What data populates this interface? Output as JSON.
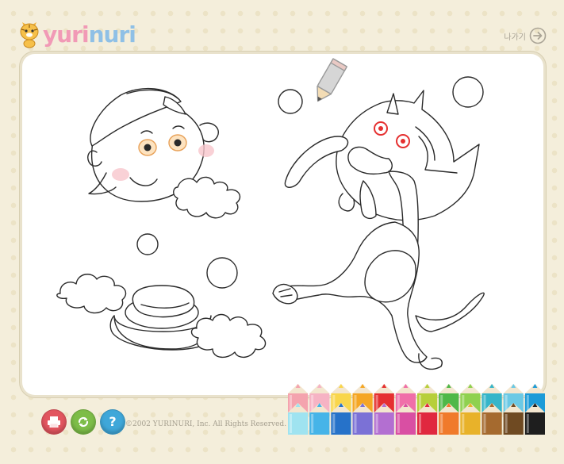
{
  "brand": {
    "logo_part1": "yuri",
    "logo_part2": "nuri"
  },
  "header": {
    "exit_label": "나가기"
  },
  "footer": {
    "copyright": "©2002 YURINURI, Inc. All Rights Reserved."
  },
  "toolbar": {
    "print_icon": "printer-icon",
    "reset_icon": "refresh-icon",
    "help_icon": "help-icon",
    "help_glyph": "?"
  },
  "palette": {
    "top_row": [
      "#f4a3ae",
      "#f6b3c4",
      "#f9d64b",
      "#f5a623",
      "#e53030",
      "#f06fa9",
      "#b7cf3a",
      "#4fb848",
      "#8fd14f",
      "#35b5c9",
      "#6bc9e5",
      "#1c9bd8"
    ],
    "bottom_row": [
      "#9fe3f0",
      "#46b4e8",
      "#2672c9",
      "#7b71d6",
      "#b36fd1",
      "#d94fa3",
      "#e0283f",
      "#f07a2b",
      "#e8b22a",
      "#a56a2f",
      "#6f4a22",
      "#1e1e1e"
    ]
  },
  "colors": {
    "accent_pink": "#f19ab6",
    "accent_blue": "#8fc0e6",
    "eye_red": "#e53030"
  }
}
